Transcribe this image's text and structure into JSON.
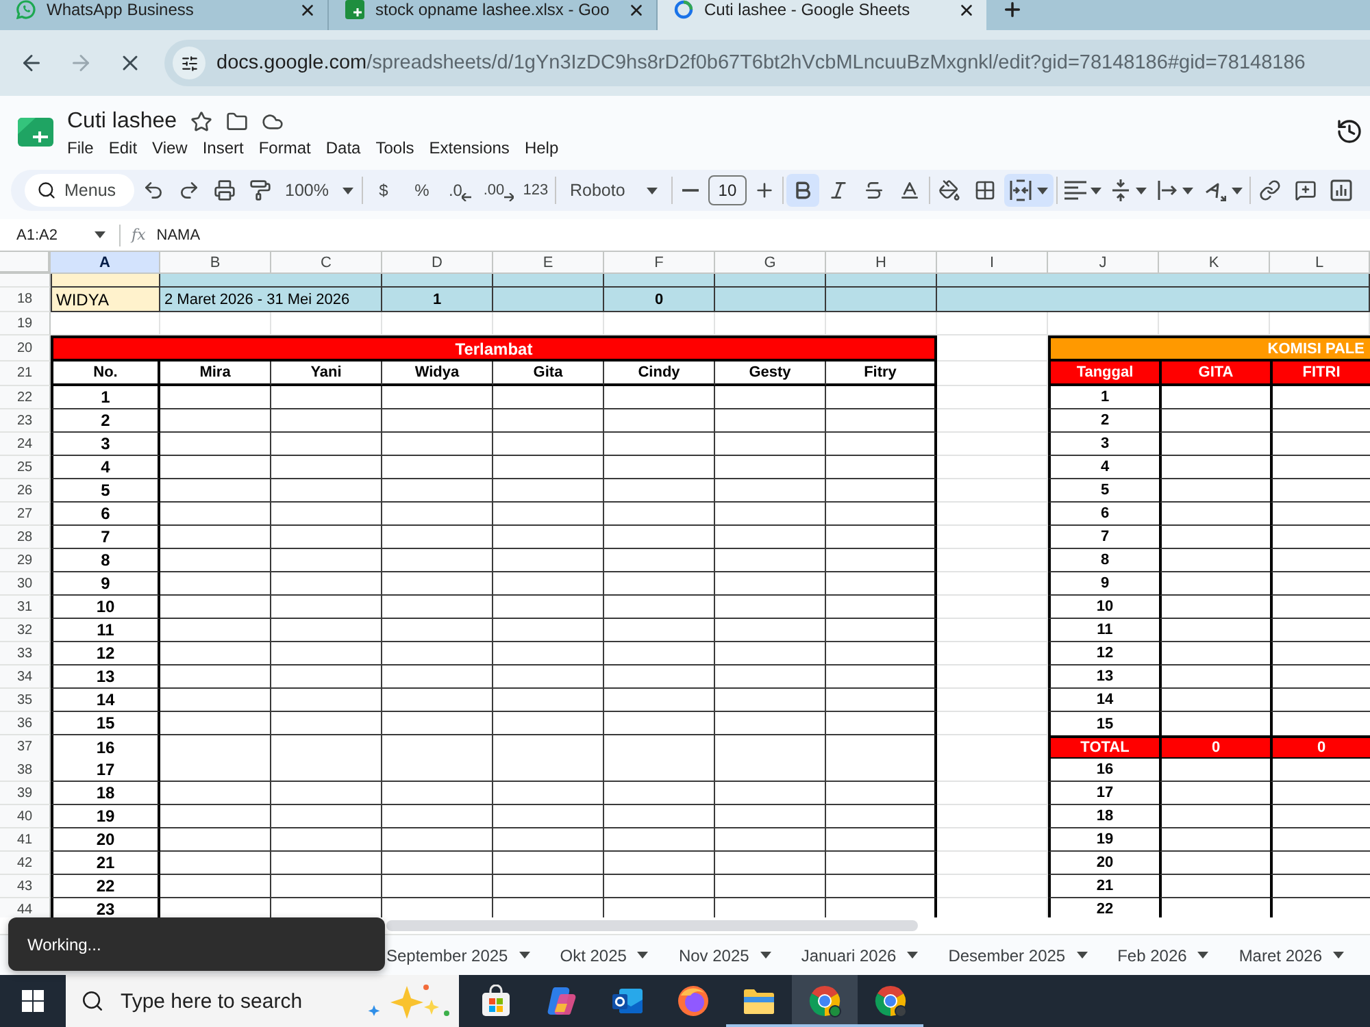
{
  "browser": {
    "tabs": [
      {
        "kind": "chat",
        "title": "WhatsApp Business",
        "selected": false
      },
      {
        "kind": "sheet",
        "title": "stock opname lashee.xlsx - Goo",
        "selected": false
      },
      {
        "kind": "loading",
        "title": "Cuti lashee - Google Sheets",
        "selected": true
      }
    ],
    "nav": {
      "back": {
        "disabled": false
      },
      "forward": {
        "disabled": true
      }
    },
    "url": "docs.google.com/spreadsheets/d/1gYn3IzDC9hs8rD2f0b67T6bt2hVcbMLncuuBzMxgnkl/edit?gid=78148186#gid=78148186"
  },
  "document": {
    "title": "Cuti lashee",
    "menus": [
      "File",
      "Edit",
      "View",
      "Insert",
      "Format",
      "Data",
      "Tools",
      "Extensions",
      "Help"
    ]
  },
  "toolbar": {
    "search": {
      "placeholder": "Menus"
    },
    "items": [
      {
        "kind": "undo"
      },
      {
        "kind": "redo"
      },
      {
        "kind": "print"
      },
      {
        "kind": "paint"
      },
      {
        "kind": "zoom",
        "label": "100%"
      },
      {
        "kind": "divider"
      },
      {
        "kind": "text",
        "label": "$"
      },
      {
        "kind": "text",
        "label": "%"
      },
      {
        "kind": "decrease",
        "label": ".0"
      },
      {
        "kind": "increase",
        "label": ".00"
      },
      {
        "kind": "text",
        "label": "123"
      },
      {
        "kind": "divider"
      },
      {
        "kind": "font",
        "label": "Roboto"
      },
      {
        "kind": "divider"
      },
      {
        "kind": "minus"
      },
      {
        "kind": "size",
        "label": "10"
      },
      {
        "kind": "plus"
      },
      {
        "kind": "divider"
      },
      {
        "kind": "bold",
        "selected": true
      },
      {
        "kind": "italic",
        "selected": false
      },
      {
        "kind": "strike",
        "selected": false
      },
      {
        "kind": "color"
      },
      {
        "kind": "divider"
      },
      {
        "kind": "fill"
      },
      {
        "kind": "borders"
      },
      {
        "kind": "merge",
        "selected": true
      },
      {
        "kind": "divider"
      },
      {
        "kind": "align"
      },
      {
        "kind": "valign"
      },
      {
        "kind": "wrap"
      },
      {
        "kind": "rotate"
      },
      {
        "kind": "divider"
      },
      {
        "kind": "link"
      },
      {
        "kind": "comment"
      },
      {
        "kind": "chart"
      }
    ]
  },
  "formula_bar": {
    "name_box": "A1:A2",
    "function_sign": "fx",
    "formula": "NAMA"
  },
  "sheet": {
    "columns": [
      {
        "label": "A",
        "selected": true
      },
      {
        "label": "B",
        "selected": false
      },
      {
        "label": "C",
        "selected": false
      },
      {
        "label": "D",
        "selected": false
      },
      {
        "label": "E",
        "selected": false
      },
      {
        "label": "F",
        "selected": false
      },
      {
        "label": "G",
        "selected": false
      },
      {
        "label": "H",
        "selected": false
      },
      {
        "label": "I",
        "selected": false
      },
      {
        "label": "J",
        "selected": false
      },
      {
        "label": "K",
        "selected": false
      },
      {
        "label": "L",
        "selected": false
      }
    ],
    "row_numbers": [
      "18",
      "19",
      "20",
      "21",
      "22",
      "23",
      "24",
      "25",
      "26",
      "27",
      "28",
      "29",
      "30",
      "31",
      "32",
      "33",
      "34",
      "35",
      "36",
      "37",
      "38",
      "39",
      "40",
      "41",
      "42",
      "43",
      "44"
    ],
    "leave_rows": [
      {
        "A": "WIDYA",
        "B": "2 Maret 2026 - 31 Mei 2026",
        "D": "1",
        "F": "0"
      }
    ],
    "late_table": {
      "title": "Terlambat",
      "headers": [
        "No.",
        "Mira",
        "Yani",
        "Widya",
        "Gita",
        "Cindy",
        "Gesty",
        "Fitry"
      ],
      "numbers": [
        "1",
        "2",
        "3",
        "4",
        "5",
        "6",
        "7",
        "8",
        "9",
        "10",
        "11",
        "12",
        "13",
        "14",
        "15",
        "16",
        "17",
        "18",
        "19",
        "20",
        "21",
        "22",
        "23"
      ]
    },
    "commission_table": {
      "title": "KOMISI PALE",
      "headers": [
        "Tanggal",
        "GITA",
        "FITRI"
      ],
      "rows": [
        {
          "kind": "day",
          "date": "1"
        },
        {
          "kind": "day",
          "date": "2"
        },
        {
          "kind": "day",
          "date": "3"
        },
        {
          "kind": "day",
          "date": "4"
        },
        {
          "kind": "day",
          "date": "5"
        },
        {
          "kind": "day",
          "date": "6"
        },
        {
          "kind": "day",
          "date": "7"
        },
        {
          "kind": "day",
          "date": "8"
        },
        {
          "kind": "day",
          "date": "9"
        },
        {
          "kind": "day",
          "date": "10"
        },
        {
          "kind": "day",
          "date": "11"
        },
        {
          "kind": "day",
          "date": "12"
        },
        {
          "kind": "day",
          "date": "13"
        },
        {
          "kind": "day",
          "date": "14"
        },
        {
          "kind": "day",
          "date": "15"
        },
        {
          "kind": "total",
          "date": "TOTAL",
          "values": [
            "0",
            "0"
          ]
        },
        {
          "kind": "day",
          "date": "16"
        },
        {
          "kind": "day",
          "date": "17"
        },
        {
          "kind": "day",
          "date": "18"
        },
        {
          "kind": "day",
          "date": "19"
        },
        {
          "kind": "day",
          "date": "20"
        },
        {
          "kind": "day",
          "date": "21"
        },
        {
          "kind": "day",
          "date": "22"
        }
      ]
    }
  },
  "sheet_tabs": [
    {
      "title": "September 2025",
      "selected": false
    },
    {
      "title": "Okt 2025",
      "selected": false
    },
    {
      "title": "Nov 2025",
      "selected": false
    },
    {
      "title": "Januari 2026",
      "selected": false
    },
    {
      "title": "Desember 2025",
      "selected": false
    },
    {
      "title": "Feb 2026",
      "selected": false
    },
    {
      "title": "Maret 2026",
      "selected": false
    }
  ],
  "toast": {
    "text": "Working..."
  },
  "taskbar": {
    "search": {
      "placeholder": "Type here to search"
    },
    "apps": [
      {
        "kind": "store",
        "open": false,
        "selected": false
      },
      {
        "kind": "swirl",
        "open": false,
        "selected": false
      },
      {
        "kind": "mail",
        "open": false,
        "selected": false
      },
      {
        "kind": "globe",
        "open": false,
        "selected": false
      },
      {
        "kind": "folder",
        "open": true,
        "selected": false
      },
      {
        "kind": "ring",
        "open": true,
        "selected": true
      },
      {
        "kind": "ring",
        "open": true,
        "selected": false
      }
    ]
  }
}
